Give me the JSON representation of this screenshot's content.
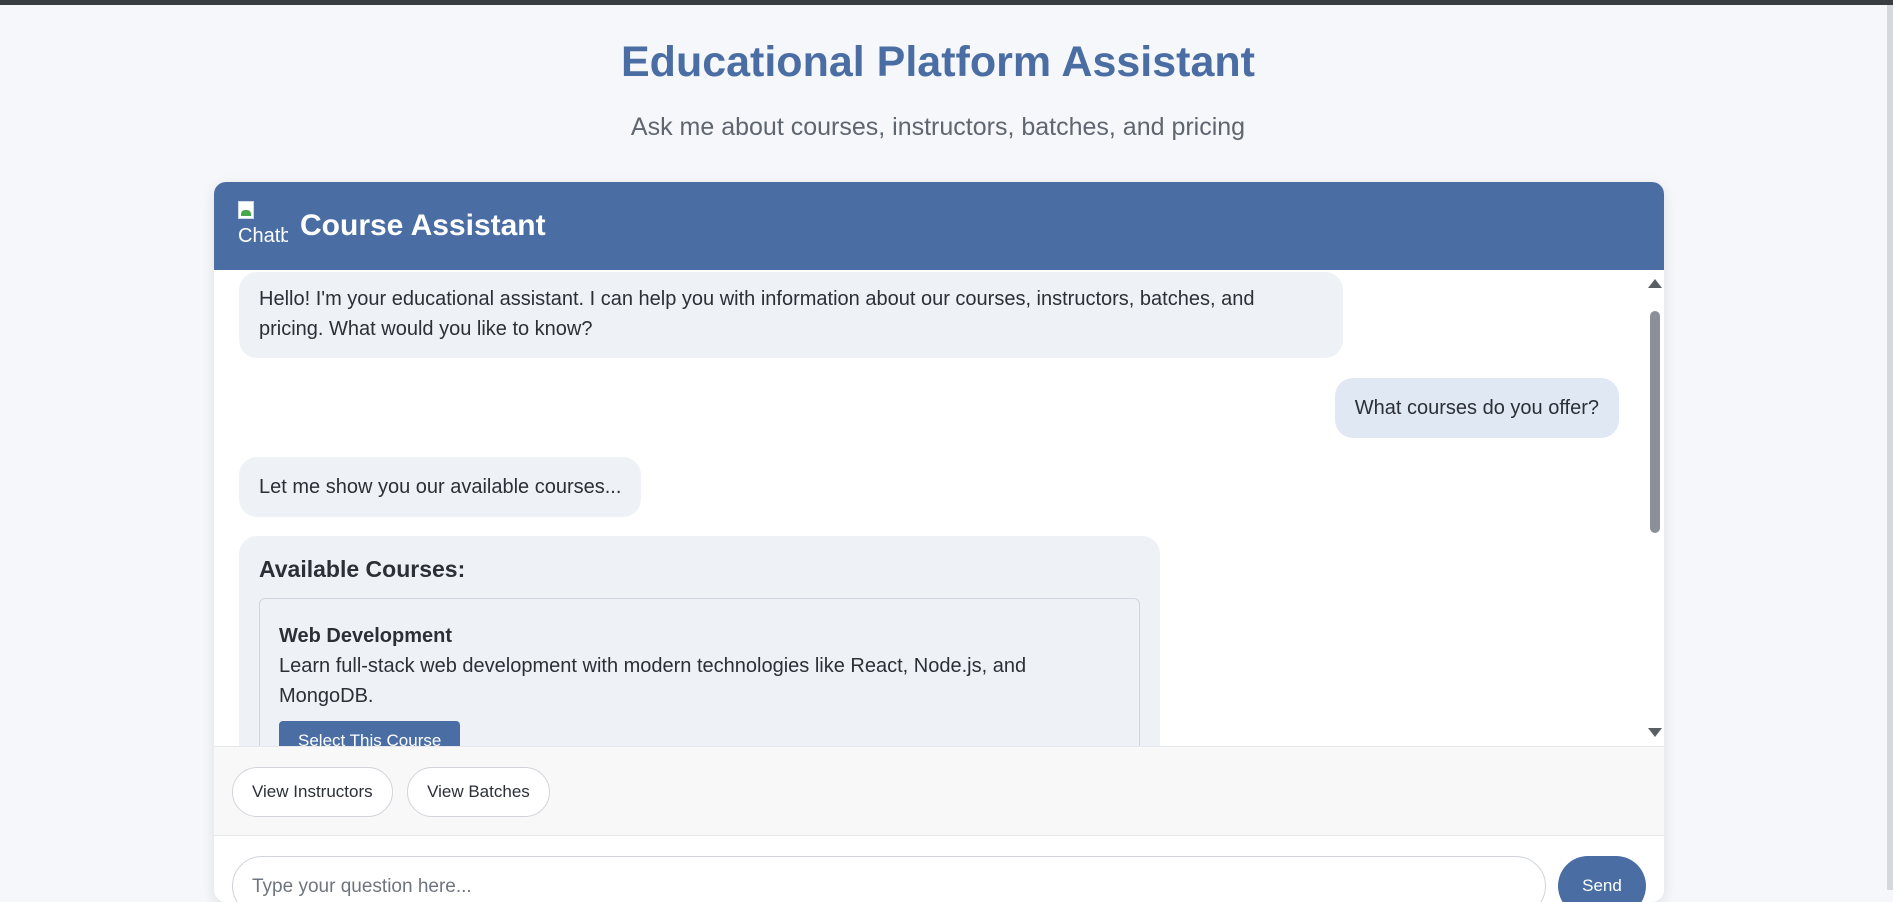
{
  "page": {
    "title": "Educational Platform Assistant",
    "subtitle": "Ask me about courses, instructors, batches, and pricing"
  },
  "chat": {
    "header_title": "Course Assistant",
    "avatar_alt": "Chatb",
    "messages": [
      {
        "sender": "bot",
        "text": "Hello! I'm your educational assistant. I can help you with information about our courses, instructors, batches, and pricing. What would you like to know?"
      },
      {
        "sender": "user",
        "text": "What courses do you offer?"
      },
      {
        "sender": "bot",
        "text": "Let me show you our available courses..."
      }
    ],
    "courses_panel": {
      "heading": "Available Courses:",
      "courses": [
        {
          "title": "Web Development",
          "description": "Learn full-stack web development with modern technologies like React, Node.js, and MongoDB.",
          "button_label": "Select This Course"
        }
      ]
    }
  },
  "quick_actions": [
    "View Instructors",
    "View Batches"
  ],
  "input": {
    "placeholder": "Type your question here...",
    "send_label": "Send"
  },
  "colors": {
    "accent": "#4a6ea4",
    "page_background": "#f5f7fa",
    "bot_bubble": "#eef2f7",
    "user_bubble": "#e0e8f3"
  }
}
